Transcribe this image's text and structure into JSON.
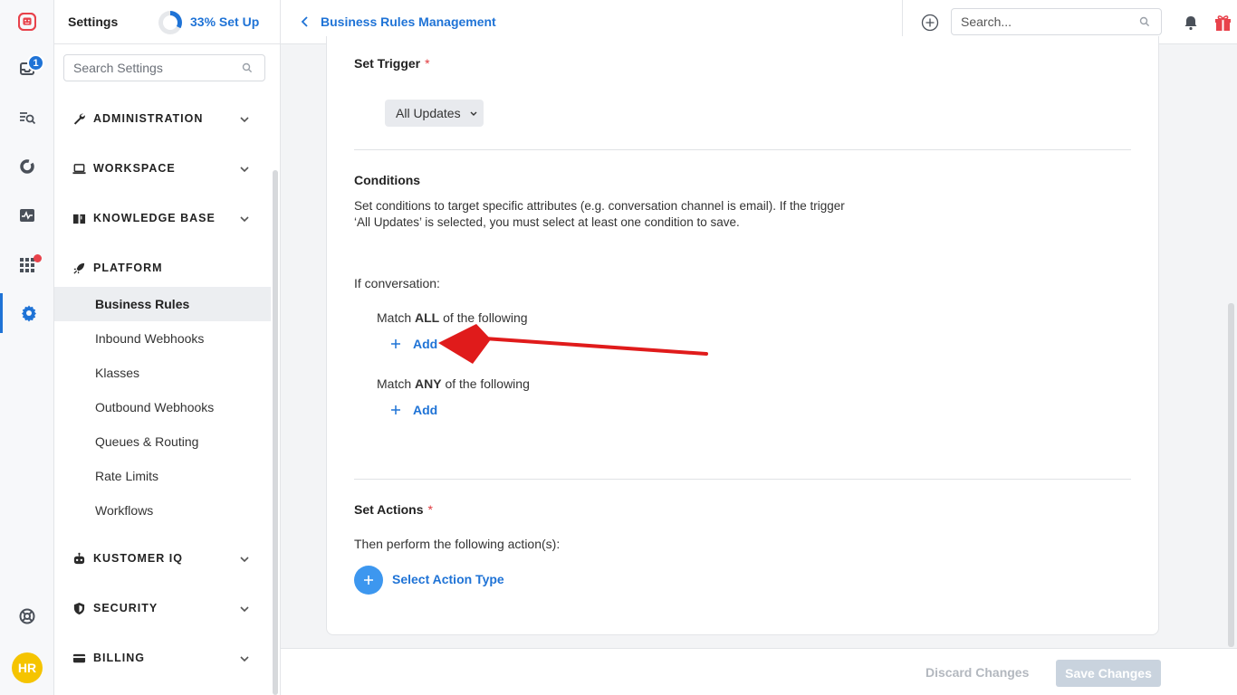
{
  "rail": {
    "inbox_badge": "1",
    "avatar_initials": "HR"
  },
  "sidebar": {
    "title": "Settings",
    "setup_progress": 0.33,
    "setup_label": "33% Set Up",
    "search_placeholder": "Search Settings",
    "sections": [
      {
        "label": "ADMINISTRATION",
        "icon": "wrench-icon"
      },
      {
        "label": "WORKSPACE",
        "icon": "laptop-icon"
      },
      {
        "label": "KNOWLEDGE BASE",
        "icon": "book-icon"
      },
      {
        "label": "PLATFORM",
        "icon": "rocket-icon"
      },
      {
        "label": "KUSTOMER IQ",
        "icon": "robot-icon"
      },
      {
        "label": "SECURITY",
        "icon": "shield-icon"
      },
      {
        "label": "BILLING",
        "icon": "credit-card-icon"
      }
    ],
    "platform_items": [
      {
        "label": "Business Rules",
        "active": true
      },
      {
        "label": "Inbound Webhooks"
      },
      {
        "label": "Klasses"
      },
      {
        "label": "Outbound Webhooks"
      },
      {
        "label": "Queues & Routing"
      },
      {
        "label": "Rate Limits"
      },
      {
        "label": "Workflows"
      }
    ]
  },
  "header": {
    "breadcrumb": "Business Rules Management",
    "search_placeholder": "Search..."
  },
  "main": {
    "trigger_label": "Set Trigger",
    "required_mark": "*",
    "trigger_value": "All Updates",
    "conditions_label": "Conditions",
    "conditions_desc": "Set conditions to target specific attributes (e.g. conversation channel is email). If the trigger ‘All Updates’ is selected, you must select at least one condition to save.",
    "if_conversation": "If conversation:",
    "match_all_prefix": "Match ",
    "match_all_bold": "ALL",
    "match_all_suffix": " of the following",
    "match_any_prefix": "Match ",
    "match_any_bold": "ANY",
    "match_any_suffix": " of the following",
    "add_label": "Add",
    "actions_label": "Set Actions",
    "actions_desc": "Then perform the following action(s):",
    "select_action": "Select Action Type"
  },
  "footer": {
    "discard": "Discard Changes",
    "save": "Save Changes"
  },
  "colors": {
    "accent": "#1f73d6",
    "required": "#e0393e",
    "arrow": "#e01b1b"
  }
}
